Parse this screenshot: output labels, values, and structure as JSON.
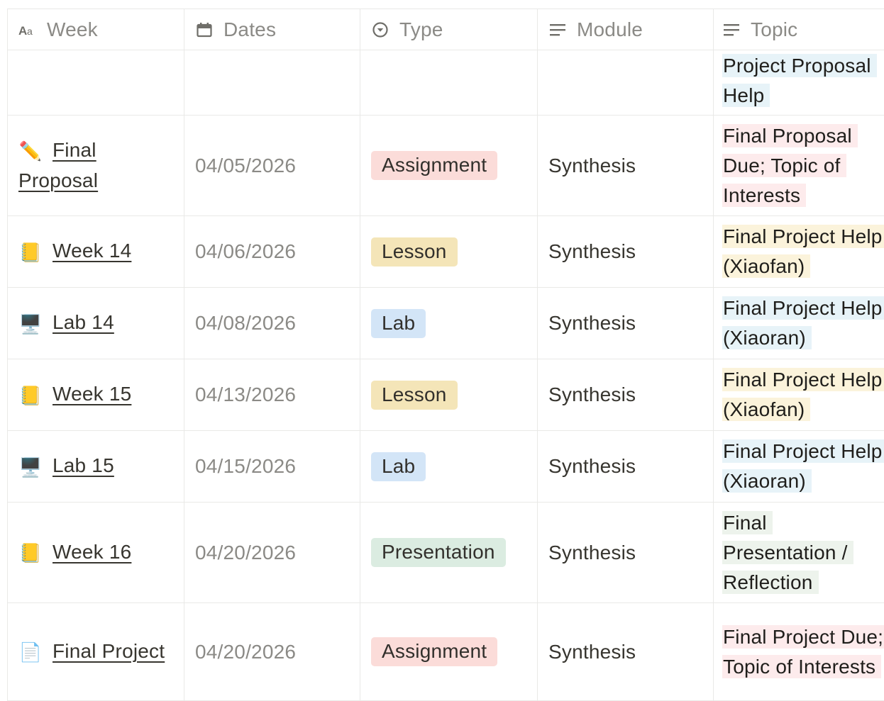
{
  "columns": {
    "week": {
      "label": "Week",
      "icon": "title-text-icon"
    },
    "dates": {
      "label": "Dates",
      "icon": "calendar-icon"
    },
    "type": {
      "label": "Type",
      "icon": "select-icon"
    },
    "module": {
      "label": "Module",
      "icon": "text-lines-icon"
    },
    "topic": {
      "label": "Topic",
      "icon": "text-lines-icon"
    }
  },
  "colors": {
    "tag_red": "#fbdcd9",
    "tag_yellow": "#f4e5b8",
    "tag_blue": "#d3e5f7",
    "tag_green": "#dbece1",
    "hl_red": "#fdebec",
    "hl_yellow": "#fbf3db",
    "hl_blue": "#e7f3f8",
    "hl_green": "#edf3ec"
  },
  "rows": [
    {
      "week": "",
      "emoji": "",
      "date": "",
      "type": "",
      "module": "",
      "topic": "Project Proposal Help",
      "topic_color": "blue"
    },
    {
      "week": "Final Proposal",
      "emoji": "pencil-icon",
      "date": "04/05/2026",
      "type": "Assignment",
      "type_color": "red",
      "module": "Synthesis",
      "topic": "Final Proposal Due; Topic of Interests",
      "topic_color": "red"
    },
    {
      "week": "Week 14",
      "emoji": "notebook-icon",
      "date": "04/06/2026",
      "type": "Lesson",
      "type_color": "yellow",
      "module": "Synthesis",
      "topic": "Final Project Help (Xiaofan)",
      "topic_color": "yellow"
    },
    {
      "week": "Lab 14",
      "emoji": "desktop-computer-icon",
      "date": "04/08/2026",
      "type": "Lab",
      "type_color": "blue",
      "module": "Synthesis",
      "topic": "Final Project Help (Xiaoran)",
      "topic_color": "blue"
    },
    {
      "week": "Week 15",
      "emoji": "notebook-icon",
      "date": "04/13/2026",
      "type": "Lesson",
      "type_color": "yellow",
      "module": "Synthesis",
      "topic": "Final Project Help (Xiaofan)",
      "topic_color": "yellow"
    },
    {
      "week": "Lab 15",
      "emoji": "desktop-computer-icon",
      "date": "04/15/2026",
      "type": "Lab",
      "type_color": "blue",
      "module": "Synthesis",
      "topic": "Final Project Help (Xiaoran)",
      "topic_color": "blue"
    },
    {
      "week": "Week 16",
      "emoji": "notebook-icon",
      "date": "04/20/2026",
      "type": "Presentation",
      "type_color": "green",
      "module": "Synthesis",
      "topic": "Final Presentation / Reflection",
      "topic_color": "green"
    },
    {
      "week": "Final Project",
      "emoji": "page-icon",
      "date": "04/20/2026",
      "type": "Assignment",
      "type_color": "red",
      "module": "Synthesis",
      "topic": "Final Project Due; Topic of Interests",
      "topic_color": "red"
    }
  ]
}
